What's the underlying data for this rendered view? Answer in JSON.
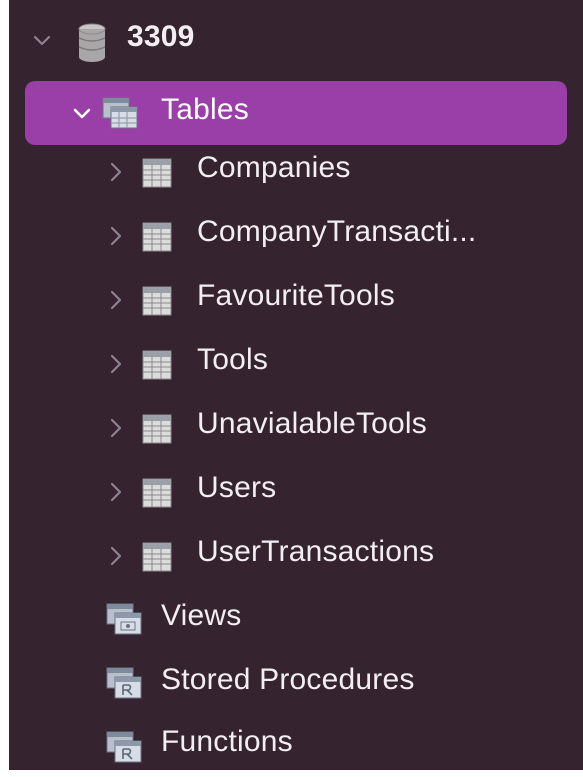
{
  "connection": {
    "name": "3309",
    "expanded": true
  },
  "tables_group": {
    "label": "Tables",
    "expanded": true,
    "selected": true
  },
  "tables": [
    {
      "label": "Companies"
    },
    {
      "label": "CompanyTransacti..."
    },
    {
      "label": "FavouriteTools"
    },
    {
      "label": "Tools"
    },
    {
      "label": "UnavialableTools"
    },
    {
      "label": "Users"
    },
    {
      "label": "UserTransactions"
    }
  ],
  "groups": {
    "views": {
      "label": "Views"
    },
    "stored_procedures": {
      "label": "Stored Procedures"
    },
    "functions": {
      "label": "Functions"
    }
  },
  "colors": {
    "sidebar_bg": "#35242f",
    "selection": "#9b3fa8",
    "text": "#f2eef2",
    "chevron": "#8e8190"
  }
}
